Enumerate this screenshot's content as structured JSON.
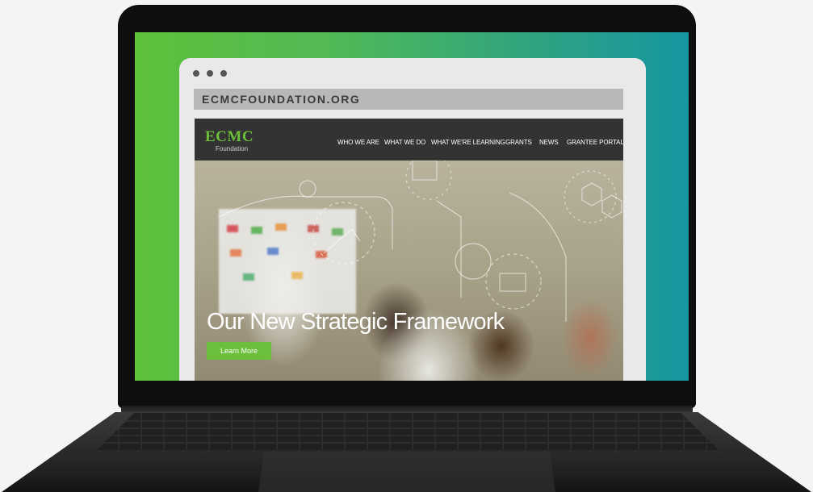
{
  "browser": {
    "url": "ECMCFOUNDATION.ORG"
  },
  "site": {
    "logo": "ECMC",
    "logo_sub": "Foundation",
    "nav": [
      "WHO WE ARE",
      "WHAT WE DO",
      "WHAT WE'RE LEARNING",
      "GRANTS",
      "NEWS",
      "GRANTEE PORTAL"
    ],
    "hero": {
      "title": "Our New Strategic Framework",
      "cta": "Learn More"
    }
  },
  "colors": {
    "brand_green": "#6bbf3a",
    "nav_bg": "#333333",
    "gradient_start": "#5cc13a",
    "gradient_end": "#1796a2"
  }
}
